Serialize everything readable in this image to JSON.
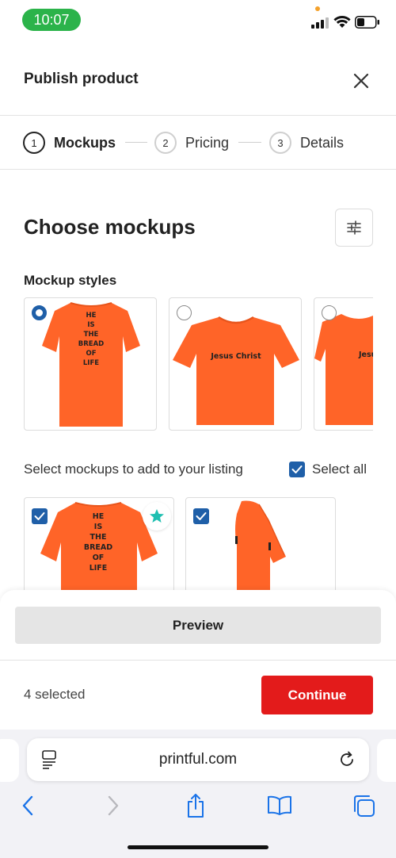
{
  "status_bar": {
    "time": "10:07"
  },
  "header": {
    "title": "Publish product"
  },
  "stepper": {
    "steps": [
      {
        "number": "1",
        "label": "Mockups"
      },
      {
        "number": "2",
        "label": "Pricing"
      },
      {
        "number": "3",
        "label": "Details"
      }
    ]
  },
  "main": {
    "title": "Choose mockups",
    "mockup_styles_label": "Mockup styles",
    "style_cards": [
      {
        "shirt_text": [
          "HE",
          "IS",
          "THE",
          "BREAD",
          "OF",
          "LIFE"
        ],
        "selected": true
      },
      {
        "shirt_text": "Jesus Christ",
        "selected": false
      },
      {
        "shirt_text": "Jesu",
        "selected": false
      }
    ],
    "select_label": "Select mockups to add to your listing",
    "select_all_label": "Select all",
    "mockup_shirt_text": [
      "HE",
      "IS",
      "THE",
      "BREAD",
      "OF",
      "LIFE"
    ]
  },
  "footer": {
    "preview_label": "Preview",
    "selected_count": "4 selected",
    "continue_label": "Continue"
  },
  "browser": {
    "url": "printful.com"
  },
  "colors": {
    "accent_red": "#e31b1b",
    "checkbox_blue": "#1f5fa8",
    "shirt_orange": "#ff6428",
    "status_green": "#2bb34a",
    "star_teal": "#1fbfb1"
  }
}
